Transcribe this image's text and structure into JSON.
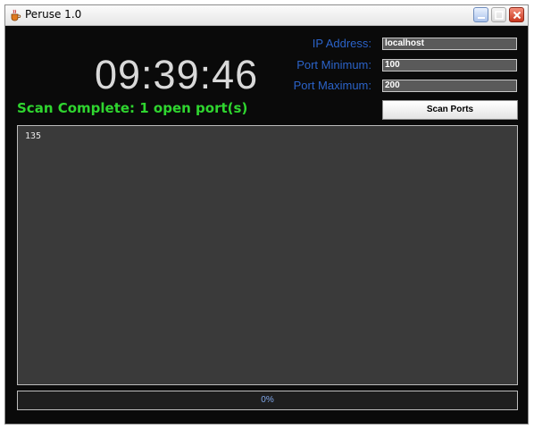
{
  "window": {
    "title": "Peruse 1.0"
  },
  "clock": {
    "time": "09:39:46"
  },
  "status": {
    "text": "Scan Complete: 1 open port(s)"
  },
  "form": {
    "ip_label": "IP Address:",
    "ip_value": "localhost",
    "port_min_label": "Port Minimum:",
    "port_min_value": "100",
    "port_max_label": "Port Maximum:",
    "port_max_value": "200",
    "scan_button_label": "Scan Ports"
  },
  "output": {
    "lines": [
      "135"
    ]
  },
  "progress": {
    "text": "0%",
    "value": 0
  },
  "colors": {
    "background": "#0a0a0a",
    "clock": "#d9d9d9",
    "status": "#2fd52f",
    "label": "#2b63c9",
    "field": "#5a5a5a",
    "output": "#3a3a3a"
  },
  "icons": {
    "app": "java-cup-icon",
    "minimize": "minimize-icon",
    "maximize": "maximize-icon",
    "close": "close-icon"
  }
}
